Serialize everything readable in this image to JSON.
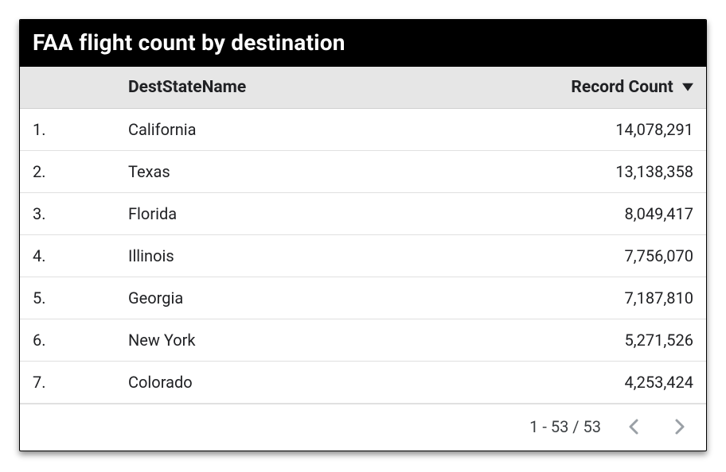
{
  "title": "FAA flight count by destination",
  "columns": {
    "rank": "",
    "state": "DestStateName",
    "count": "Record Count"
  },
  "rows": [
    {
      "rank": "1.",
      "state": "California",
      "count": "14,078,291"
    },
    {
      "rank": "2.",
      "state": "Texas",
      "count": "13,138,358"
    },
    {
      "rank": "3.",
      "state": "Florida",
      "count": "8,049,417"
    },
    {
      "rank": "4.",
      "state": "Illinois",
      "count": "7,756,070"
    },
    {
      "rank": "5.",
      "state": "Georgia",
      "count": "7,187,810"
    },
    {
      "rank": "6.",
      "state": "New York",
      "count": "5,271,526"
    },
    {
      "rank": "7.",
      "state": "Colorado",
      "count": "4,253,424"
    }
  ],
  "pagination": {
    "range": "1 - 53 / 53"
  },
  "chart_data": {
    "type": "table",
    "title": "FAA flight count by destination",
    "columns": [
      "DestStateName",
      "Record Count"
    ],
    "sort": {
      "column": "Record Count",
      "direction": "desc"
    },
    "total_rows": 53,
    "visible_range": "1 - 53 / 53",
    "data": [
      {
        "DestStateName": "California",
        "Record Count": 14078291
      },
      {
        "DestStateName": "Texas",
        "Record Count": 13138358
      },
      {
        "DestStateName": "Florida",
        "Record Count": 8049417
      },
      {
        "DestStateName": "Illinois",
        "Record Count": 7756070
      },
      {
        "DestStateName": "Georgia",
        "Record Count": 7187810
      },
      {
        "DestStateName": "New York",
        "Record Count": 5271526
      },
      {
        "DestStateName": "Colorado",
        "Record Count": 4253424
      }
    ]
  }
}
